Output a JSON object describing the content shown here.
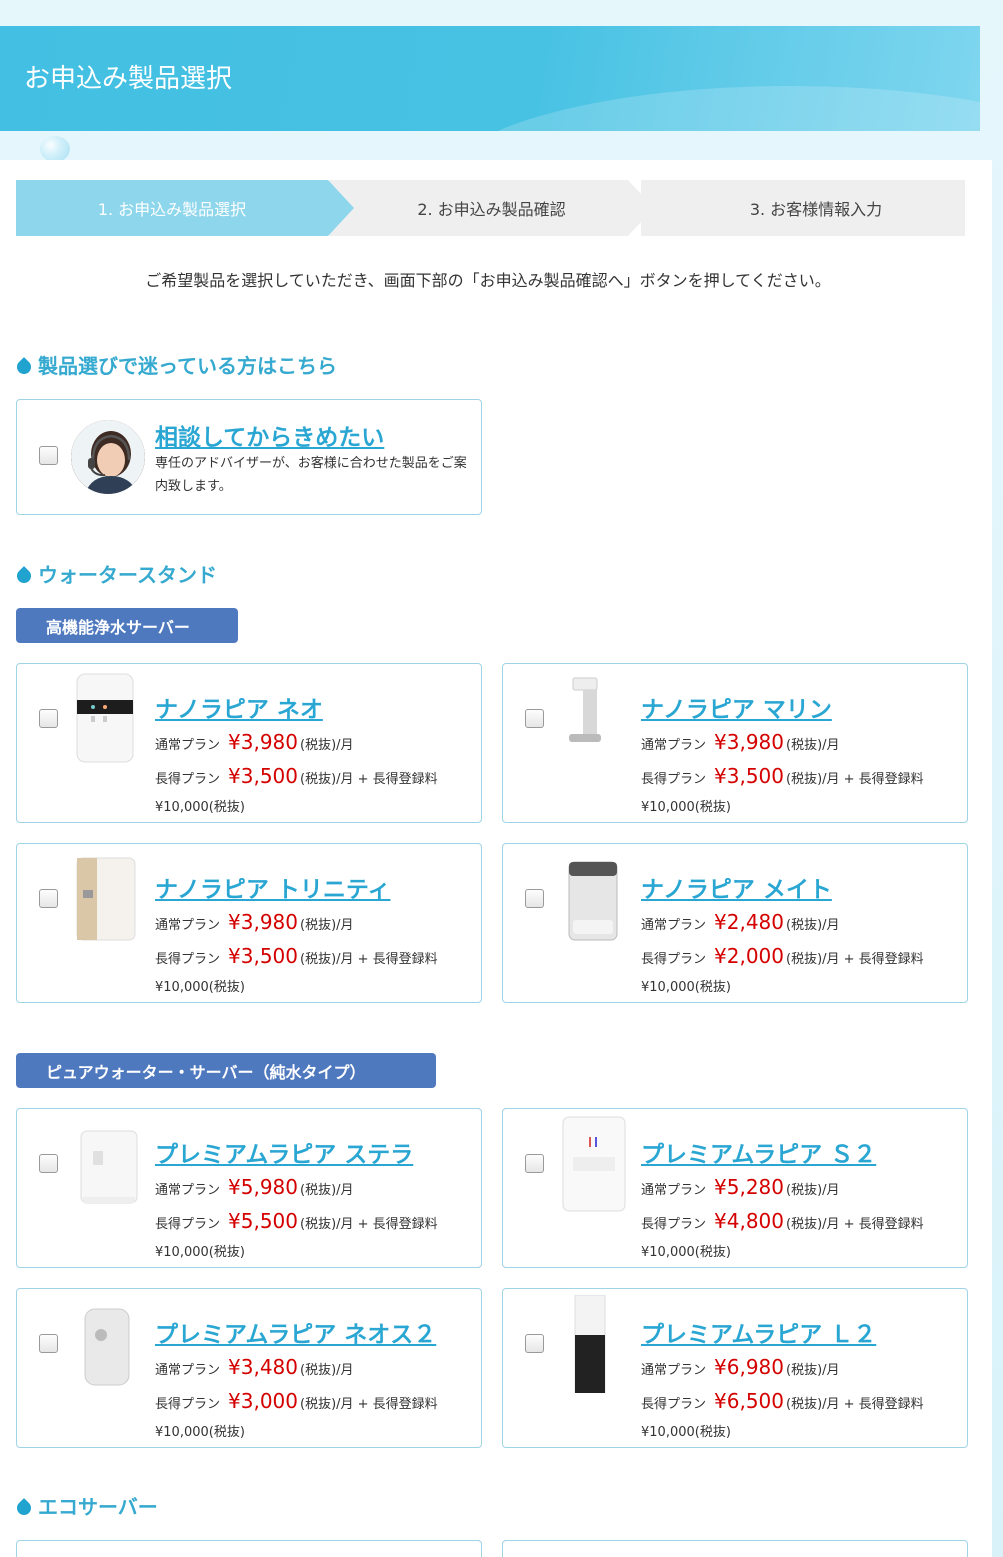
{
  "header": {
    "title": "お申込み製品選択"
  },
  "steps": [
    {
      "label": "1. お申込み製品選択"
    },
    {
      "label": "2. お申込み製品確認"
    },
    {
      "label": "3. お客様情報入力"
    }
  ],
  "intro": "ご希望製品を選択していただき、画面下部の「お申込み製品確認へ」ボタンを押してください。",
  "sections": {
    "consult_title": "製品選びで迷っている方はこちら",
    "water_title": "ウォータースタンド",
    "eco_title": "エコサーバー"
  },
  "subs": {
    "high": "高機能浄水サーバー",
    "pure": "ピュアウォーター・サーバー（純水タイプ）"
  },
  "consult": {
    "name": "相談してからきめたい",
    "desc": "専任のアドバイザーが、お客様に合わせた製品をご案内致します。"
  },
  "labels": {
    "normal": "通常プラン",
    "long": "長得プラン",
    "tax_month": "(税抜)/月",
    "long_fee": "(税抜)/月 + 長得登録料",
    "fee": "¥10,000(税抜)"
  },
  "products": [
    {
      "name": "ナノラピア ネオ",
      "normal": "¥3,980",
      "long": "¥3,500"
    },
    {
      "name": "ナノラピア マリン",
      "normal": "¥3,980",
      "long": "¥3,500"
    },
    {
      "name": "ナノラピア トリニティ",
      "normal": "¥3,980",
      "long": "¥3,500"
    },
    {
      "name": "ナノラピア メイト",
      "normal": "¥2,480",
      "long": "¥2,000"
    },
    {
      "name": "プレミアムラピア ステラ",
      "normal": "¥5,980",
      "long": "¥5,500"
    },
    {
      "name": "プレミアムラピア Ｓ２",
      "normal": "¥5,280",
      "long": "¥4,800"
    },
    {
      "name": "プレミアムラピア ネオス２",
      "normal": "¥3,480",
      "long": "¥3,000"
    },
    {
      "name": "プレミアムラピア Ｌ２",
      "normal": "¥6,980",
      "long": "¥6,500"
    }
  ]
}
